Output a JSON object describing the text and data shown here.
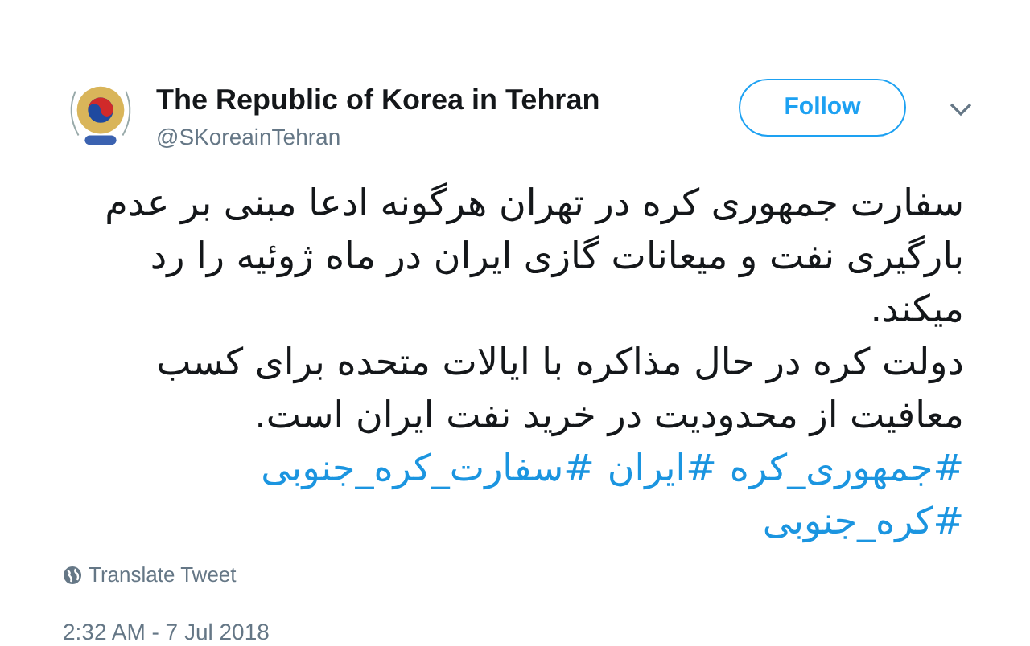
{
  "account": {
    "name": "The Republic of Korea in Tehran",
    "handle": "@SKoreainTehran"
  },
  "follow_button": {
    "label": "Follow"
  },
  "tweet": {
    "paragraphs": [
      "سفارت جمهوری کره در تهران هرگونه ادعا مبنی بر عدم بارگیری نفت و میعانات گازی ایران در ماه ژوئیه را رد میکند.",
      "دولت کره در حال مذاکره با ایالات متحده برای کسب معافیت از محدودیت در خرید نفت ایران است."
    ],
    "hashtags": [
      "#جمهوری_کره",
      "#ایران",
      "#سفارت_کره_جنوبی",
      "#کره_جنوبی"
    ]
  },
  "translate": {
    "label": "Translate Tweet"
  },
  "timestamp": "2:32 AM - 7 Jul 2018"
}
